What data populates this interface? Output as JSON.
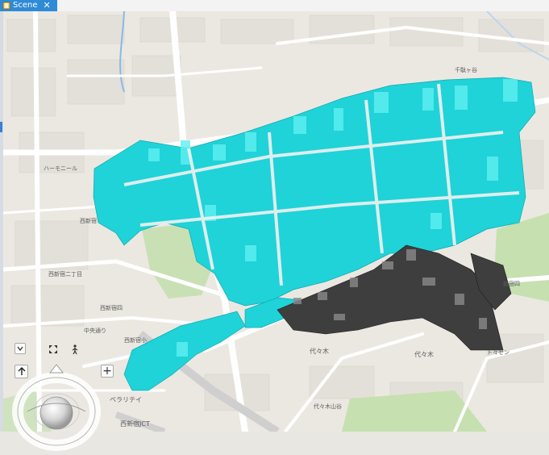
{
  "tab": {
    "label": "Scene",
    "close_glyph": "✕",
    "icon": "scene-globe-icon",
    "color": "#2f8ad8"
  },
  "map": {
    "labels": {
      "haremuar": "ハーモニール",
      "nishishinjuku": "西新宿",
      "nishishinjuku2": "西新宿二丁目",
      "nishishinjuku_west": "西新宿四",
      "yoyogi": "代々木",
      "yoyogi2": "代々木",
      "yoyogisanyo": "代々木山谷",
      "tozen": "ト々ゼン",
      "shinjuku_jct": "西新宿JCT",
      "peraita": "ペラリテイ",
      "nishishinjuku_sho": "西新宿小",
      "shinjuku_yon": "新宿四",
      "chuo": "中央通り",
      "sendagaya": "千駄ヶ谷"
    },
    "colors": {
      "buildings_highlight": "#1fd3d8",
      "buildings_dark": "#3a3a3a",
      "park": "#c8e2b5",
      "background": "#e9e7e1"
    }
  },
  "controls": {
    "collapse": "collapse-icon",
    "fullextent": "full-extent-icon",
    "walk": "walk-icon",
    "up": "up-arrow-icon",
    "zoom_in": "+",
    "zoom_in_icon": "plus-icon",
    "navigator": "navigator-ring"
  }
}
